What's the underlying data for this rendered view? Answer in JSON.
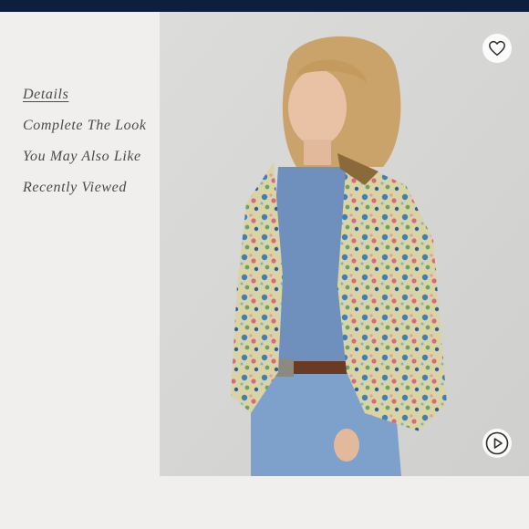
{
  "nav": {
    "items": [
      {
        "label": "Details",
        "active": true
      },
      {
        "label": "Complete The Look",
        "active": false
      },
      {
        "label": "You May Also Like",
        "active": false
      },
      {
        "label": "Recently Viewed",
        "active": false
      }
    ]
  },
  "product_image": {
    "subject": "Woman wearing floral print jacket over chambray shirt with jeans"
  },
  "icons": {
    "favorite": "heart-icon",
    "video": "play-icon"
  },
  "colors": {
    "header_bar": "#0d1f3c",
    "sidebar_bg": "#f1efed",
    "photo_bg": "#d6d6d4",
    "nav_text": "#4a4a4a"
  }
}
